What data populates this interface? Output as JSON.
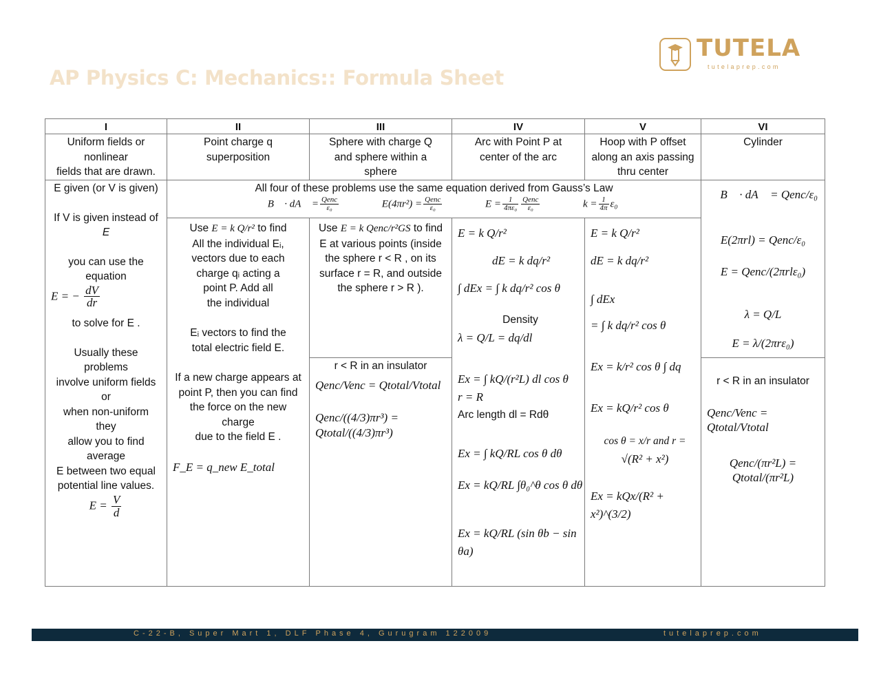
{
  "document": {
    "title": "AP Physics C: Mechanics:: Formula Sheet",
    "logo": {
      "brand": "TUTELA",
      "url": "tutelaprep.com",
      "icon": "graduation-pencil-icon"
    },
    "footer": {
      "address": "C-22-B, Super Mart 1, DLF Phase 4, Gurugram 122009",
      "url": "tutelaprep.com"
    }
  },
  "table": {
    "headers": [
      "I",
      "II",
      "III",
      "IV",
      "V",
      "VI"
    ],
    "descriptions": [
      [
        "Uniform fields or",
        "nonlinear",
        "fields that are drawn."
      ],
      [
        "Point charge q",
        "superposition"
      ],
      [
        "Sphere with charge Q",
        "and sphere within a",
        "sphere"
      ],
      [
        "Arc with Point P at",
        "center of the arc"
      ],
      [
        "Hoop with P offset",
        "along an axis passing",
        "thru center"
      ],
      [
        "Cylinder"
      ]
    ],
    "col1": {
      "lines": [
        "E given (or V is given)",
        "If V is given instead of",
        "E",
        "you can use the",
        "equation"
      ],
      "eq1": "E = − dV / dr",
      "eq1_lhs": "E = −",
      "eq1_num": "dV",
      "eq1_den": "dr",
      "after": "to solve for E .",
      "usually": [
        "Usually these",
        "problems",
        "involve uniform fields",
        "or",
        "when non-uniform",
        "they",
        "allow you to find",
        "average",
        "E between two equal",
        "potential line values."
      ],
      "eq2_lhs": "E =",
      "eq2_num": "V",
      "eq2_den": "d"
    },
    "gauss_banner": {
      "text": "All four of these problems use the same equation derived from Gauss’s Law",
      "eqs": [
        {
          "lhs": "∮ B⃗ · dA⃗ =",
          "num": "Qenc",
          "den": "ε₀"
        },
        {
          "lhs": "E(4πr²) =",
          "num": "Qenc",
          "den": "ε₀"
        },
        {
          "lhs": "E =",
          "num": "1",
          "den": "4πε₀",
          "num2": "Qenc",
          "den2": "ε₀"
        },
        {
          "lhs": "k =",
          "num": "1",
          "den": "4π",
          "tail": "ε₀"
        }
      ]
    },
    "col2": {
      "use_prefix": "Use",
      "use_eq": "E = k Q/r²",
      "use_suffix": "to find",
      "lines": [
        "All the individual Eᵢ,",
        "vectors due to each",
        "charge qᵢ acting a",
        "point P. Add all",
        "the individual"
      ],
      "lines2": [
        "Eᵢ vectors to find the",
        "total electric field E."
      ],
      "lines3": [
        "If a new charge appears at",
        "point P, then you can find",
        "the force on the new",
        "charge",
        "due to the field E ."
      ],
      "force_eq": "F_E = q_new E_total"
    },
    "col3": {
      "use_prefix": "Use",
      "use_eq": "E = k Qenc/r²GS",
      "use_suffix": "to find",
      "lines": [
        "E at various points (inside",
        "the sphere r < R , on its",
        "surface r = R, and outside",
        "the sphere r > R )."
      ],
      "insulator_label": "r < R in an insulator",
      "eq_a": "Qenc/Venc = Qtotal/Vtotal",
      "eq_b": "Qenc/((4/3)πr³) = Qtotal/((4/3)πr³)"
    },
    "col4": {
      "eqs": [
        "E = k Q/r²",
        "dE = k dq/r²",
        "∫ dEx = ∫ k dq/r² cos θ"
      ],
      "density_label": "Density",
      "density_eq": "λ = Q/L = dq/dl",
      "eqs2": [
        "Ex = ∫ kQ/(r²L) dl cos θ",
        "r = R",
        "Arc length dl = Rdθ",
        "Ex = ∫ kQ/RL cos θ dθ",
        "Ex = kQ/RL ∫θ₀^θ cos θ dθ",
        "Ex = kQ/RL (sin θb − sin θa)"
      ]
    },
    "col5": {
      "eqs": [
        "E = k Q/r²",
        "dE = k dq/r²",
        "∫ dEx",
        "= ∫ k dq/r² cos θ",
        "Ex = k/r² cos θ ∫ dq",
        "Ex = kQ/r² cos θ"
      ],
      "cos_text": "cos θ = x/r and r =",
      "sqrt": "√(R² + x²)",
      "final": "Ex = kQx/(R² + x²)^(3/2)"
    },
    "col6": {
      "eqs": [
        "∮ B⃗ · dA⃗ = Qenc/ε₀",
        "E(2πrl) = Qenc/ε₀",
        "E = Qenc/(2πrlε₀)",
        "λ = Q/L",
        "E = λ/(2πrε₀)"
      ],
      "insulator_label": "r < R in an insulator",
      "eq_a": "Qenc/Venc = Qtotal/Vtotal",
      "eq_b": "Qenc/(πr²L) = Qtotal/(πr²L)"
    }
  }
}
